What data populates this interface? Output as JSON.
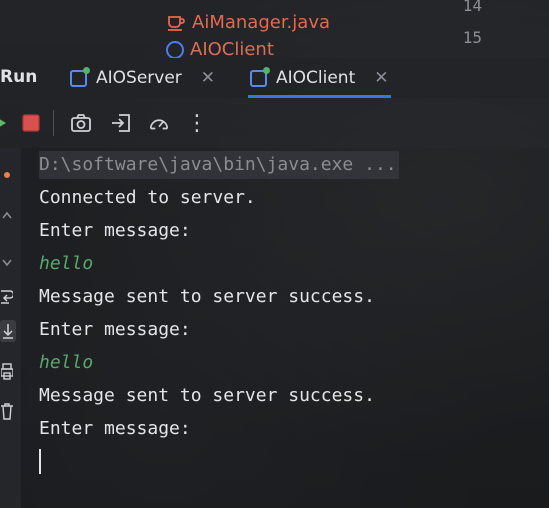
{
  "editor": {
    "file1": "AiManager.java",
    "file2": "AIOClient",
    "line_14": "14",
    "line_15": "15"
  },
  "run_panel": {
    "label": "Run",
    "tabs": [
      {
        "label": "AIOServer",
        "active": false
      },
      {
        "label": "AIOClient",
        "active": true
      }
    ],
    "close_glyph": "✕"
  },
  "toolbar": {
    "icons": [
      "rerun-icon",
      "stop-icon",
      "screenshot-icon",
      "exit-icon",
      "gauge-icon",
      "more-icon"
    ],
    "more_glyph": "⋮"
  },
  "console": {
    "lines": [
      {
        "text": "D:\\software\\java\\bin\\java.exe ...",
        "kind": "cmd"
      },
      {
        "text": "Connected to server.",
        "kind": "output"
      },
      {
        "text": "Enter message:",
        "kind": "output"
      },
      {
        "text": "hello",
        "kind": "input"
      },
      {
        "text": "Message sent to server success.",
        "kind": "output"
      },
      {
        "text": "Enter message:",
        "kind": "output"
      },
      {
        "text": "hello",
        "kind": "input"
      },
      {
        "text": "Message sent to server success.",
        "kind": "output"
      },
      {
        "text": "Enter message:",
        "kind": "output"
      }
    ]
  },
  "colors": {
    "accent": "#3574f0",
    "input_text": "#5aa86c",
    "file_name": "#e4694f"
  }
}
